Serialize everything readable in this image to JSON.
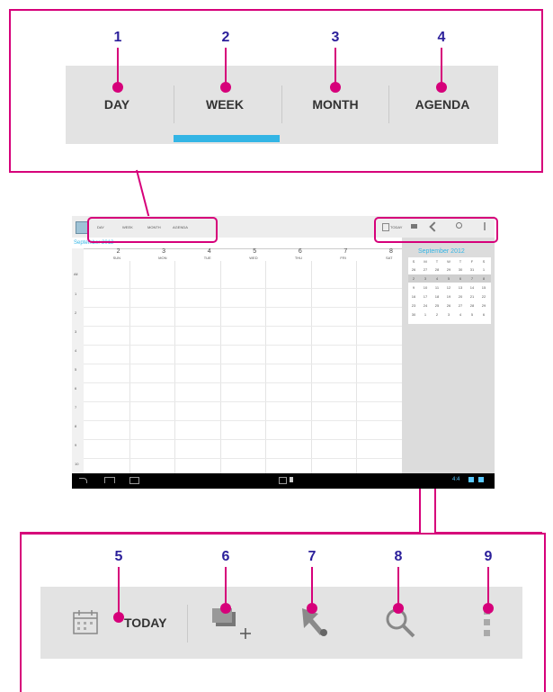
{
  "top_tabs": {
    "numbers": [
      "1",
      "2",
      "3",
      "4"
    ],
    "labels": [
      "DAY",
      "WEEK",
      "MONTH",
      "AGENDA"
    ],
    "selected": "WEEK",
    "accent": "#33b5e5"
  },
  "bottom_actions": {
    "numbers": [
      "5",
      "6",
      "7",
      "8",
      "9"
    ],
    "today_label": "TODAY",
    "icons": [
      "calendar-icon",
      "new-event-icon",
      "go-to-date-icon",
      "search-icon",
      "overflow-menu-icon"
    ]
  },
  "screenshot": {
    "tabs": [
      "DAY",
      "WEEK",
      "MONTH",
      "AGENDA"
    ],
    "today_label": "TODAY",
    "month_title": "September 2012",
    "day_numbers": [
      "2",
      "3",
      "4",
      "5",
      "6",
      "7",
      "8"
    ],
    "day_names": [
      "SUN",
      "MON",
      "TUE",
      "WED",
      "THU",
      "FRI",
      "SAT"
    ],
    "hours": [
      "1",
      "2",
      "3",
      "4",
      "5",
      "6",
      "7",
      "8",
      "9",
      "10",
      "11"
    ],
    "all_day": "All",
    "mini_month_title": "September 2012",
    "mini_weekdays": [
      "S",
      "M",
      "T",
      "W",
      "T",
      "F",
      "S"
    ],
    "mini_weeks": [
      [
        "26",
        "27",
        "28",
        "29",
        "30",
        "31",
        "1"
      ],
      [
        "2",
        "3",
        "4",
        "5",
        "6",
        "7",
        "8"
      ],
      [
        "9",
        "10",
        "11",
        "12",
        "13",
        "14",
        "15"
      ],
      [
        "16",
        "17",
        "18",
        "19",
        "20",
        "21",
        "22"
      ],
      [
        "23",
        "24",
        "25",
        "26",
        "27",
        "28",
        "29"
      ],
      [
        "30",
        "1",
        "2",
        "3",
        "4",
        "5",
        "6"
      ]
    ],
    "status_time": "4:4"
  },
  "colors": {
    "callout": "#d6007a",
    "number": "#2b1f9a",
    "bar": "#e3e3e3",
    "accent": "#33b5e5"
  }
}
